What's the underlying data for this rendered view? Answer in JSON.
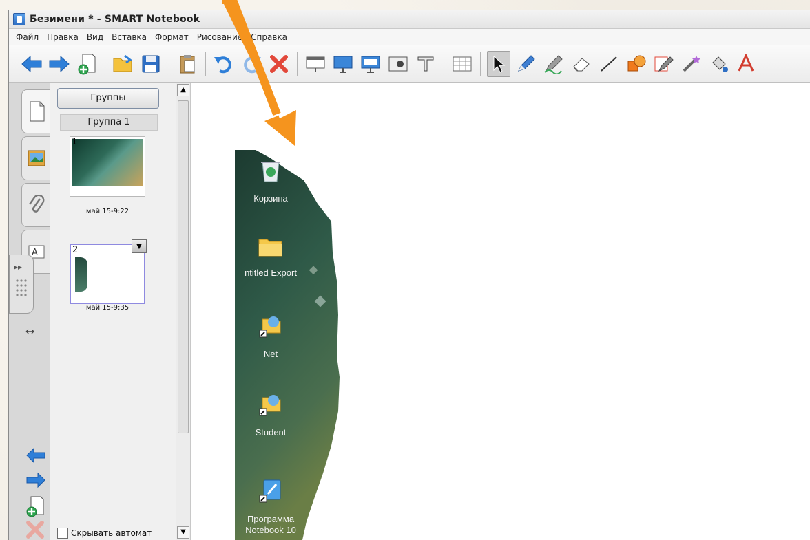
{
  "window": {
    "title": "Безимени * - SMART Notebook"
  },
  "menu": {
    "items": [
      "Файл",
      "Правка",
      "Вид",
      "Вставка",
      "Формат",
      "Рисование",
      "Справка"
    ]
  },
  "toolbar": {
    "icons": [
      "back-arrow-icon",
      "forward-arrow-icon",
      "add-page-icon",
      "open-folder-icon",
      "save-icon",
      "paste-icon",
      "undo-icon",
      "redo-icon",
      "delete-icon",
      "screen-shade-icon",
      "full-screen-icon",
      "dual-display-icon",
      "capture-icon",
      "document-camera-icon",
      "table-icon",
      "select-pointer-icon",
      "pen-icon",
      "creative-pen-icon",
      "eraser-icon",
      "line-icon",
      "shape-icon",
      "magic-pen-icon",
      "fill-icon",
      "text-icon"
    ]
  },
  "sorter": {
    "groups_button": "Группы",
    "group_label": "Группа 1",
    "pages": [
      {
        "number": "1",
        "caption": "май 15-9:22"
      },
      {
        "number": "2",
        "caption": "май 15-9:35"
      }
    ],
    "autohide_label": "Скрывать автомат"
  },
  "desktop_icons": [
    {
      "label": "Корзина",
      "icon": "recycle-bin-icon"
    },
    {
      "label": "ntitled Export",
      "icon": "folder-icon"
    },
    {
      "label": "Net",
      "icon": "network-shortcut-icon"
    },
    {
      "label": "Student",
      "icon": "student-shortcut-icon"
    },
    {
      "label": "Программа Notebook 10",
      "icon": "notebook-shortcut-icon"
    }
  ],
  "colors": {
    "accent_arrow": "#f5941e",
    "desktop_dark": "#1f3a30",
    "desktop_mid": "#3d6a54"
  }
}
